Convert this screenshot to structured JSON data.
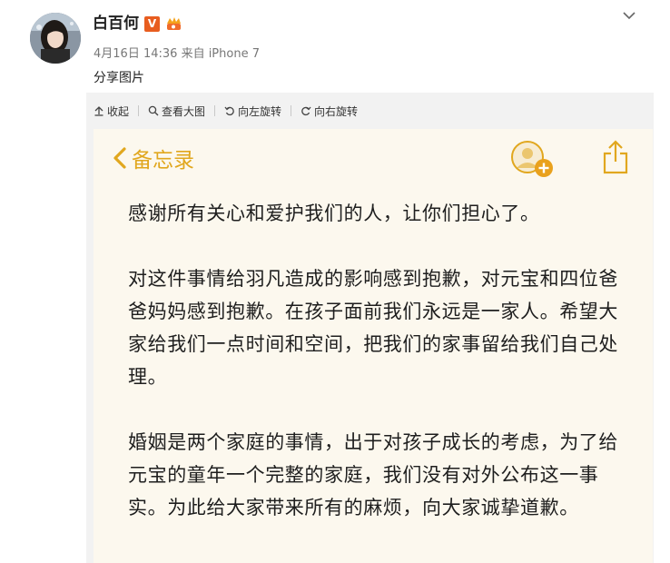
{
  "post": {
    "username": "白百何",
    "badge_v": "V",
    "timestamp": "4月16日 14:36",
    "source": "来自 iPhone 7",
    "share_text": "分享图片"
  },
  "toolbar": {
    "collapse": "收起",
    "view_large": "查看大图",
    "rotate_left": "向左旋转",
    "rotate_right": "向右旋转"
  },
  "note": {
    "back_label": "备忘录",
    "paragraphs": [
      "感谢所有关心和爱护我们的人，让你们担心了。",
      "对这件事情给羽凡造成的影响感到抱歉，对元宝和四位爸爸妈妈感到抱歉。在孩子面前我们永远是一家人。希望大家给我们一点时间和空间，把我们的家事留给我们自己处理。",
      "婚姻是两个家庭的事情，出于对孩子成长的考虑，为了给元宝的童年一个完整的家庭，我们没有对外公布这一事实。为此给大家带来所有的麻烦，向大家诚挚道歉。"
    ]
  },
  "colors": {
    "accent": "#e1a71e",
    "badge_v": "#e85d1f",
    "note_bg": "#fcf8ee",
    "panel_bg": "#f2f2f2"
  },
  "icons": [
    "avatar-photo",
    "verified-v-badge",
    "vip-badge",
    "chevron-down-icon",
    "collapse-icon",
    "magnifier-icon",
    "rotate-left-icon",
    "rotate-right-icon",
    "back-chevron-icon",
    "add-person-icon",
    "share-icon"
  ]
}
